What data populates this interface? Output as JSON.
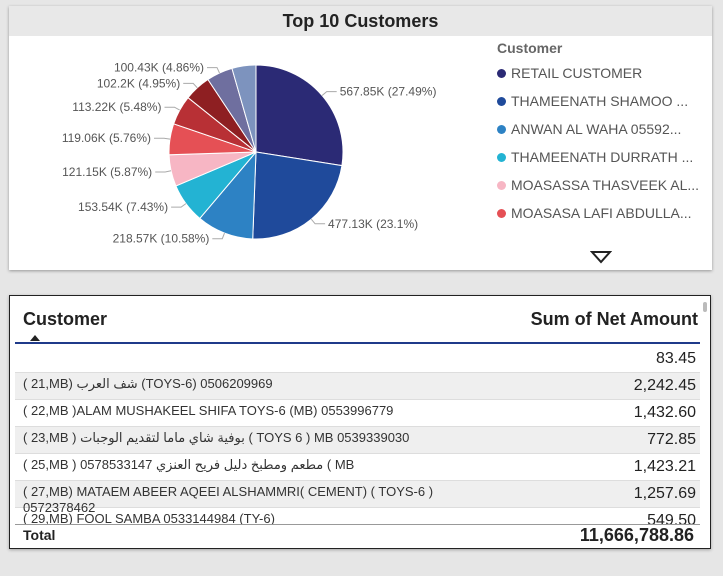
{
  "chart_data": {
    "type": "pie",
    "title": "Top 10 Customers",
    "legend_title": "Customer",
    "legend_placement": "right",
    "slices": [
      {
        "label": "567.85K (27.49%)",
        "value": 567.85,
        "color": "#2b2a75"
      },
      {
        "label": "477.13K (23.1%)",
        "value": 477.13,
        "color": "#1f4a9b"
      },
      {
        "label": "218.57K (10.58%)",
        "value": 218.57,
        "color": "#2d82c4"
      },
      {
        "label": "153.54K (7.43%)",
        "value": 153.54,
        "color": "#23b3d3"
      },
      {
        "label": "121.15K (5.87%)",
        "value": 121.15,
        "color": "#f7b6c4"
      },
      {
        "label": "119.06K (5.76%)",
        "value": 119.06,
        "color": "#e55055"
      },
      {
        "label": "113.22K (5.48%)",
        "value": 113.22,
        "color": "#b83035"
      },
      {
        "label": "102.2K (4.95%)",
        "value": 102.2,
        "color": "#8e1f22"
      },
      {
        "label": "100.43K (4.86%)",
        "value": 100.43,
        "color": "#6f6f9f"
      },
      {
        "label": "",
        "value": 92.0,
        "color": "#7d93be"
      }
    ],
    "legend": [
      {
        "name": "RETAIL  CUSTOMER",
        "color": "#2b2a75"
      },
      {
        "name": "THAMEENATH SHAMOO ...",
        "color": "#1f4a9b"
      },
      {
        "name": "ANWAN AL WAHA  05592...",
        "color": "#2d82c4"
      },
      {
        "name": "THAMEENATH DURRATH ...",
        "color": "#23b3d3"
      },
      {
        "name": "MOASASSA THASVEEK AL...",
        "color": "#f7b6c4"
      },
      {
        "name": "MOASASA LAFI ABDULLA...",
        "color": "#e55055"
      }
    ]
  },
  "table": {
    "col_customer": "Customer",
    "col_amount": "Sum of Net Amount",
    "rows": [
      {
        "customer": "",
        "amount": "83.45"
      },
      {
        "customer": "( 21,MB) شف العرب (TOYS-6) 0506209969",
        "amount": "2,242.45"
      },
      {
        "customer": "( 22,MB )ALAM MUSHAKEEL SHIFA TOYS-6 (MB) 0553996779",
        "amount": "1,432.60"
      },
      {
        "customer": "( 23,MB ) بوفية شاي ماما لتقديم الوجبات ( TOYS 6 ) MB 0539339030",
        "amount": "772.85"
      },
      {
        "customer": "( 25,MB ) مطعم ومطبخ دليل فريح العنزي 0578533147 ( MB",
        "amount": "1,423.21"
      },
      {
        "customer": "( 27,MB) MATAEM ABEER AQEEI ALSHAMMRI( CEMENT) ( TOYS-6 ) 0572378462",
        "amount": "1,257.69"
      },
      {
        "customer": "( 29,MB) FOOL SAMBA 0533144984 (TY-6)",
        "amount": "549.50"
      }
    ],
    "total_label": "Total",
    "total_value": "11,666,788.86"
  }
}
